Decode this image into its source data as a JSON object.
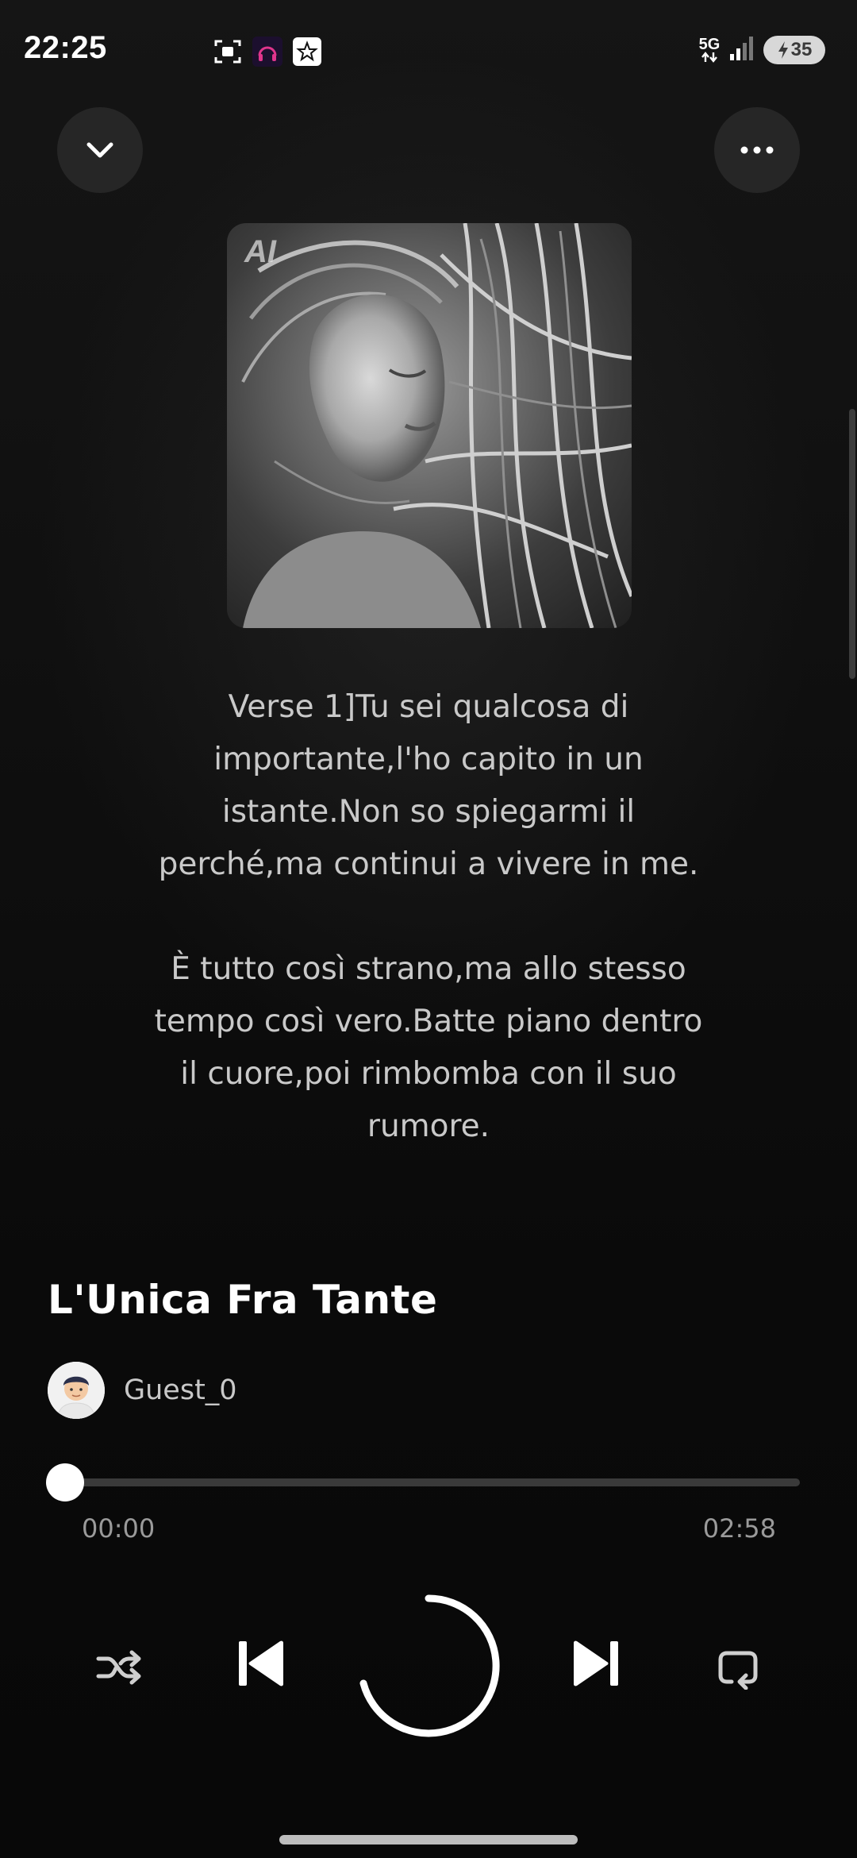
{
  "status_bar": {
    "time": "22:25",
    "network": "5G",
    "battery_level": "35",
    "left_icons": [
      "screen-record-icon",
      "podcast-app-icon",
      "star-app-icon"
    ],
    "right_icons": [
      "signal-icon",
      "battery-charging-icon"
    ]
  },
  "header": {
    "collapse_icon": "chevron-down-icon",
    "more_icon": "more-horizontal-icon"
  },
  "cover": {
    "badge": "AI"
  },
  "lyrics": {
    "stanza_1": [
      "Verse 1]Tu sei qualcosa di",
      "importante,l'ho capito in un",
      "istante.Non so spiegarmi il",
      "perché,ma continui a vivere in me."
    ],
    "stanza_2": [
      "È tutto così strano,ma allo stesso",
      "tempo così vero.Batte piano dentro",
      "il cuore,poi rimbomba con il suo",
      "rumore."
    ]
  },
  "song": {
    "title": "L'Unica Fra Tante",
    "artist": "Guest_0"
  },
  "player": {
    "current_time": "00:00",
    "total_time": "02:58",
    "progress": 0.0,
    "state": "loading",
    "controls": [
      "shuffle-icon",
      "previous-icon",
      "play-loading-icon",
      "next-icon",
      "repeat-icon"
    ]
  },
  "colors": {
    "background": "#0b0b0b",
    "accent": "#ffffff",
    "muted_text": "#9a9a9a",
    "lyrics_text": "#c9c9c9"
  }
}
